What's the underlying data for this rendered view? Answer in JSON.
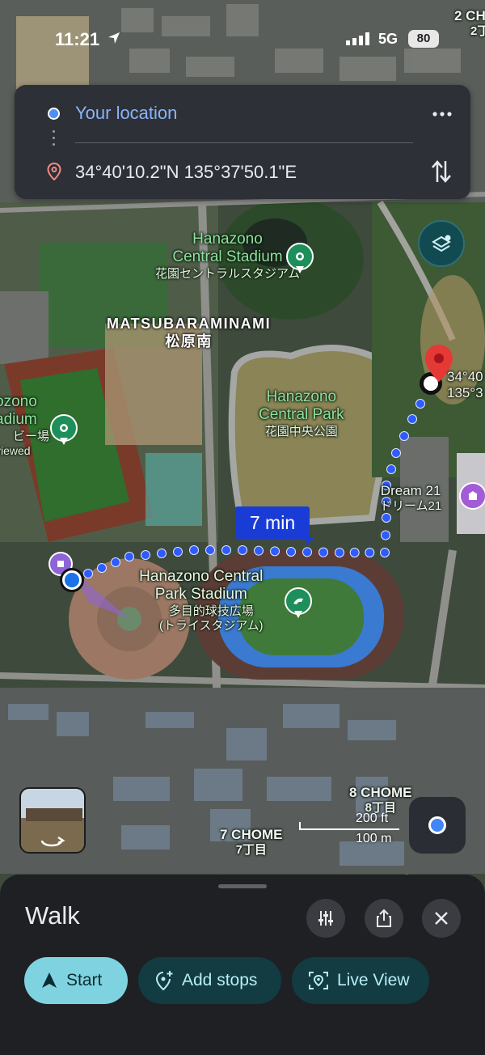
{
  "status_bar": {
    "time": "11:21",
    "network": "5G",
    "battery": "80"
  },
  "route": {
    "origin": "Your location",
    "destination": "34°40'10.2\"N 135°37'50.1\"E",
    "more_icon": "more-horizontal-icon",
    "swap_icon": "swap-vertical-icon"
  },
  "map": {
    "district": {
      "en": "MATSUBARAMINAMI",
      "jp": "松原南"
    },
    "places": [
      {
        "en": "Hanazono\nCentral Stadium",
        "jp": "花園セントラルスタジアム"
      },
      {
        "en": "Hanazono\nCentral Park",
        "jp": "花園中央公園"
      },
      {
        "en": "Hanazono Central\nPark Stadium",
        "jp": "多目的球技広場\n(トライスタジアム)"
      },
      {
        "en": "Dream 21",
        "jp": "ドリーム21"
      },
      {
        "en": "ozono\nadium",
        "jp": "ビー場"
      },
      {
        "en": "viewed"
      }
    ],
    "chome": [
      {
        "en": "8 CHOME",
        "jp": "8丁目"
      },
      {
        "en": "7 CHOME",
        "jp": "7丁目"
      },
      {
        "en": "2 CH",
        "jp": "2丁"
      }
    ],
    "dest_coords_partial": [
      "34°40",
      "135°3"
    ],
    "walk_time": "7 min",
    "scale": {
      "ft": "200 ft",
      "m": "100 m"
    }
  },
  "sheet": {
    "mode": "Walk",
    "buttons": {
      "start": "Start",
      "add_stops": "Add stops",
      "live_view": "Live View"
    }
  },
  "colors": {
    "route": "#1a3cd6",
    "accent": "#7fd3e0",
    "pin": "#e53935"
  }
}
